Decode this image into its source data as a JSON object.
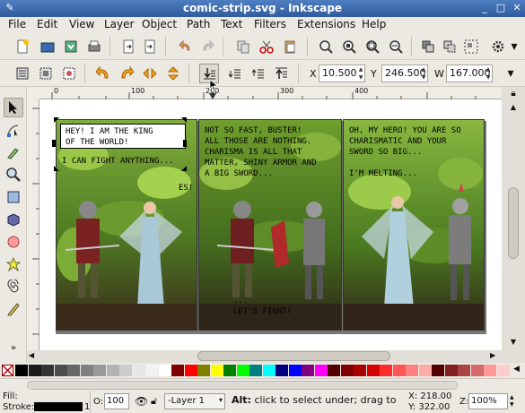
{
  "window": {
    "title": "comic-strip.svg - Inkscape"
  },
  "menu": [
    "File",
    "Edit",
    "View",
    "Layer",
    "Object",
    "Path",
    "Text",
    "Filters",
    "Extensions",
    "Help"
  ],
  "coords": {
    "x_label": "X",
    "x_value": "10.500",
    "y_label": "Y",
    "y_value": "246.500",
    "w_label": "W",
    "w_value": "167.000"
  },
  "ruler": {
    "h_ticks": [
      "0",
      "100",
      "200",
      "300",
      "400"
    ]
  },
  "comic": {
    "panel1": {
      "bubble": "HEY! I AM THE KING\nOF THE WORLD!",
      "caption": "I CAN FIGHT ANYTHING...",
      "side": "ES!"
    },
    "panel2": {
      "caption": "NOT SO FAST, BUSTER!\nALL THOSE ARE NOTHING.\nCHARISMA IS ALL THAT\nMATTER, SHINY ARMOR AND\nA BIG SWORD...",
      "bottom": "...\nLET'S FIGHT!"
    },
    "panel3": {
      "caption": "OH, MY HERO! YOU ARE SO\nCHARISMATIC AND YOUR\nSWORD SO BIG...\n\nI'M MELTING..."
    }
  },
  "status": {
    "fill_label": "Fill:",
    "stroke_label": "Stroke:",
    "stroke_width": "1",
    "opacity_label": "O:",
    "opacity_value": "100",
    "layer": "-Layer 1",
    "hint_bold": "Alt:",
    "hint": " click to select under; drag to",
    "x_readout": "X: 218.00",
    "y_readout": "Y: 322.00",
    "zoom_label": "Z:",
    "zoom": "100%"
  },
  "palette_colors": [
    "#000000",
    "#1a1a1a",
    "#333333",
    "#4d4d4d",
    "#666666",
    "#808080",
    "#999999",
    "#b3b3b3",
    "#cccccc",
    "#e6e6e6",
    "#f2f2f2",
    "#ffffff",
    "#800000",
    "#ff0000",
    "#808000",
    "#ffff00",
    "#008000",
    "#00ff00",
    "#008080",
    "#00ffff",
    "#000080",
    "#0000ff",
    "#800080",
    "#ff00ff",
    "#550000",
    "#800000",
    "#aa0000",
    "#d40000",
    "#ff2a2a",
    "#ff5555",
    "#ff8080",
    "#ffaaaa",
    "#550000",
    "#802020",
    "#aa4444",
    "#d46a6a",
    "#ff9999",
    "#ffcccc"
  ],
  "colors": {
    "titlebar": "#2e5c9e",
    "accent": "#4f7fc0"
  }
}
